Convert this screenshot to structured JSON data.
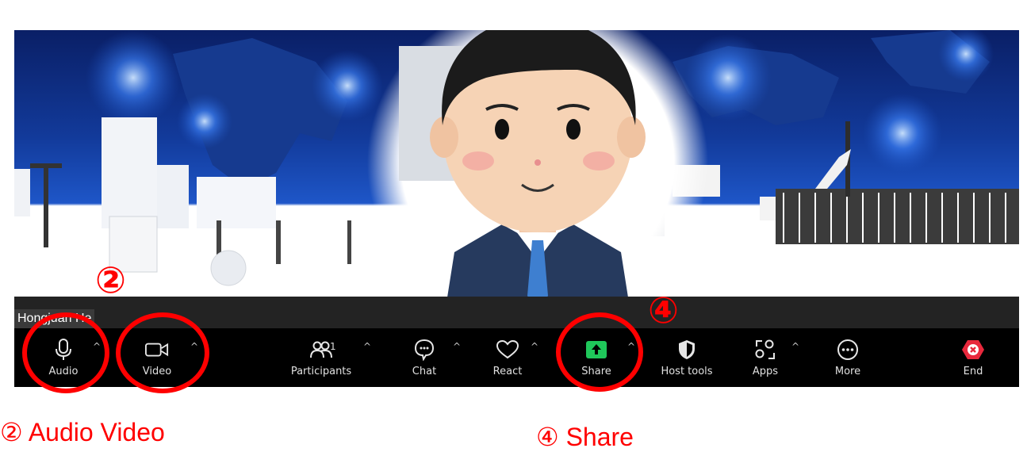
{
  "participant_name": "Hongjuan He",
  "toolbar": {
    "audio_label": "Audio",
    "video_label": "Video",
    "participants_label": "Participants",
    "participants_count": "1",
    "chat_label": "Chat",
    "react_label": "React",
    "share_label": "Share",
    "host_tools_label": "Host tools",
    "apps_label": "Apps",
    "more_label": "More",
    "end_label": "End",
    "caret": "^"
  },
  "annotations": {
    "marker_2": "②",
    "marker_4": "④",
    "caption_audio_video": "② Audio   Video",
    "caption_share": "④ Share",
    "color": "#ff0000"
  },
  "colors": {
    "share_green": "#1fc75a",
    "end_red": "#e8283c",
    "toolbar_bg": "#000000",
    "name_bar_bg": "#232323"
  },
  "icons": {
    "audio": "microphone-icon",
    "video": "camera-icon",
    "participants": "people-icon",
    "chat": "chat-bubble-icon",
    "react": "heart-icon",
    "share": "share-arrow-icon",
    "host_tools": "shield-icon",
    "apps": "apps-icon",
    "more": "more-dots-icon",
    "end": "end-x-icon"
  }
}
